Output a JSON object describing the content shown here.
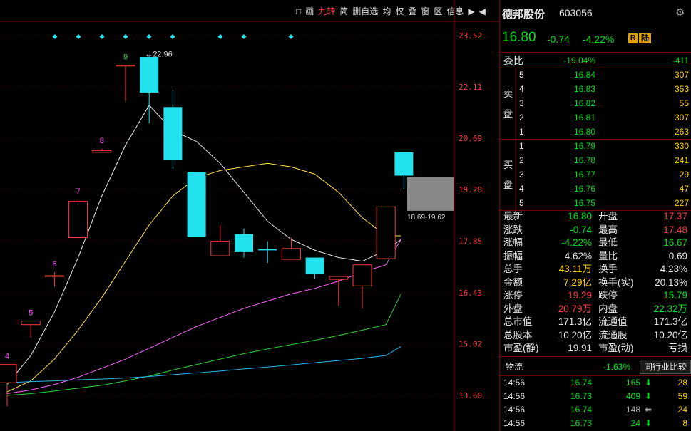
{
  "toolbar": {
    "items": [
      "□",
      "画",
      "九转",
      "简",
      "删自选",
      "均",
      "权",
      "叠",
      "窗",
      "区",
      "信息",
      "▶",
      "◀"
    ],
    "active_index": 2
  },
  "chart": {
    "yticks": [
      "23.52",
      "22.11",
      "20.69",
      "19.28",
      "17.85",
      "16.43",
      "15.02",
      "13.60"
    ],
    "high_label": "←22.96",
    "range_label": "18.69-19.62",
    "nine_turn": [
      "4",
      "5",
      "6",
      "7",
      "8",
      "9"
    ]
  },
  "chart_data": {
    "type": "candlestick",
    "ylim": [
      13.6,
      23.52
    ],
    "candles": [
      {
        "o": 13.95,
        "c": 14.45,
        "h": 14.45,
        "l": 13.3,
        "dir": "up",
        "label": "4"
      },
      {
        "o": 15.55,
        "c": 15.65,
        "h": 15.65,
        "l": 15.2,
        "dir": "up",
        "label": "5"
      },
      {
        "o": 16.88,
        "c": 16.9,
        "h": 17.0,
        "l": 16.6,
        "dir": "up",
        "label": "6"
      },
      {
        "o": 17.95,
        "c": 18.95,
        "h": 19.0,
        "l": 17.95,
        "dir": "up",
        "label": "7"
      },
      {
        "o": 20.3,
        "c": 20.35,
        "h": 20.4,
        "l": 20.3,
        "dir": "up",
        "label": "8"
      },
      {
        "o": 22.7,
        "c": 22.7,
        "h": 22.7,
        "l": 21.7,
        "dir": "up",
        "label": "9"
      },
      {
        "o": 22.93,
        "c": 21.95,
        "h": 22.96,
        "l": 21.1,
        "dir": "down"
      },
      {
        "o": 21.55,
        "c": 20.1,
        "h": 22.0,
        "l": 19.85,
        "dir": "down"
      },
      {
        "o": 19.75,
        "c": 17.98,
        "h": 19.75,
        "l": 17.98,
        "dir": "down"
      },
      {
        "o": 17.45,
        "c": 17.85,
        "h": 18.3,
        "l": 17.45,
        "dir": "up"
      },
      {
        "o": 18.05,
        "c": 17.55,
        "h": 18.2,
        "l": 17.4,
        "dir": "down"
      },
      {
        "o": 17.62,
        "c": 17.62,
        "h": 17.85,
        "l": 17.25,
        "dir": "flat"
      },
      {
        "o": 17.35,
        "c": 17.65,
        "h": 17.95,
        "l": 17.35,
        "dir": "up"
      },
      {
        "o": 17.4,
        "c": 16.95,
        "h": 17.4,
        "l": 16.8,
        "dir": "down"
      },
      {
        "o": 16.8,
        "c": 16.88,
        "h": 16.88,
        "l": 16.07,
        "dir": "up"
      },
      {
        "o": 16.62,
        "c": 17.2,
        "h": 17.2,
        "l": 16.0,
        "dir": "up"
      },
      {
        "o": 17.37,
        "c": 18.8,
        "h": 18.8,
        "l": 17.37,
        "dir": "up"
      },
      {
        "o": 20.3,
        "c": 19.66,
        "h": 20.3,
        "l": 19.28,
        "dir": "down"
      }
    ],
    "ma_series": [
      {
        "color": "#e8e8e8",
        "values": [
          13.9,
          14.7,
          15.9,
          17.4,
          19.1,
          20.5,
          21.6,
          20.9,
          20.6,
          20.0,
          19.2,
          18.4,
          17.9,
          17.6,
          17.4,
          17.3,
          17.6,
          17.9
        ]
      },
      {
        "color": "#ffe14a",
        "values": [
          13.7,
          14.0,
          14.6,
          15.4,
          16.3,
          17.3,
          18.3,
          19.1,
          19.6,
          19.8,
          19.9,
          20.0,
          19.9,
          19.7,
          19.2,
          18.5,
          18.0,
          18.0
        ]
      },
      {
        "color": "#ff66ff",
        "values": [
          13.65,
          13.75,
          13.9,
          14.1,
          14.35,
          14.6,
          14.9,
          15.2,
          15.5,
          15.75,
          16.0,
          16.2,
          16.4,
          16.55,
          16.75,
          17.0,
          17.2,
          17.9
        ]
      },
      {
        "color": "#2fd13a",
        "values": [
          13.6,
          13.65,
          13.72,
          13.8,
          13.88,
          14.0,
          14.13,
          14.3,
          14.45,
          14.6,
          14.75,
          14.88,
          15.0,
          15.12,
          15.25,
          15.4,
          15.55,
          16.4
        ]
      },
      {
        "color": "#27b6f0",
        "values": [
          13.95,
          13.98,
          14.0,
          14.03,
          14.05,
          14.08,
          14.12,
          14.17,
          14.22,
          14.27,
          14.33,
          14.38,
          14.44,
          14.5,
          14.56,
          14.62,
          14.7,
          14.95
        ]
      }
    ]
  },
  "stock": {
    "name": "德邦股份",
    "code": "603056",
    "price": "16.80",
    "change": "-0.74",
    "pct": "-4.22%",
    "badge_r": "R",
    "badge_lu": "陆"
  },
  "weibi": {
    "label": "委比",
    "pct": "-19.04%",
    "diff": "-411"
  },
  "sell_label": [
    "卖",
    "盘"
  ],
  "buy_label": [
    "买",
    "盘"
  ],
  "sell": [
    {
      "n": "5",
      "price": "16.84",
      "vol": "307"
    },
    {
      "n": "4",
      "price": "16.83",
      "vol": "353"
    },
    {
      "n": "3",
      "price": "16.82",
      "vol": "55"
    },
    {
      "n": "2",
      "price": "16.81",
      "vol": "307"
    },
    {
      "n": "1",
      "price": "16.80",
      "vol": "263"
    }
  ],
  "buy": [
    {
      "n": "1",
      "price": "16.79",
      "vol": "330"
    },
    {
      "n": "2",
      "price": "16.78",
      "vol": "241"
    },
    {
      "n": "3",
      "price": "16.77",
      "vol": "29"
    },
    {
      "n": "4",
      "price": "16.76",
      "vol": "47"
    },
    {
      "n": "5",
      "price": "16.75",
      "vol": "227"
    }
  ],
  "stats": [
    {
      "k1": "最新",
      "v1": "16.80",
      "c1": "green",
      "k2": "开盘",
      "v2": "17.37",
      "c2": "red"
    },
    {
      "k1": "涨跌",
      "v1": "-0.74",
      "c1": "green",
      "k2": "最高",
      "v2": "17.48",
      "c2": "red"
    },
    {
      "k1": "涨幅",
      "v1": "-4.22%",
      "c1": "green",
      "k2": "最低",
      "v2": "16.67",
      "c2": "green"
    },
    {
      "k1": "振幅",
      "v1": "4.62%",
      "c1": "white",
      "k2": "量比",
      "v2": "0.69",
      "c2": "white"
    },
    {
      "k1": "总手",
      "v1": "43.11万",
      "c1": "yellow",
      "k2": "换手",
      "v2": "4.23%",
      "c2": "white"
    },
    {
      "k1": "金额",
      "v1": "7.29亿",
      "c1": "yellow",
      "k2": "换手(实)",
      "v2": "20.13%",
      "c2": "white"
    },
    {
      "k1": "涨停",
      "v1": "19.29",
      "c1": "red",
      "k2": "跌停",
      "v2": "15.79",
      "c2": "green"
    },
    {
      "k1": "外盘",
      "v1": "20.79万",
      "c1": "red",
      "k2": "内盘",
      "v2": "22.32万",
      "c2": "green"
    },
    {
      "k1": "总市值",
      "v1": "171.3亿",
      "c1": "white",
      "k2": "流通值",
      "v2": "171.3亿",
      "c2": "white"
    },
    {
      "k1": "总股本",
      "v1": "10.20亿",
      "c1": "white",
      "k2": "流通股",
      "v2": "10.20亿",
      "c2": "white"
    },
    {
      "k1": "市盈(静)",
      "v1": "19.91",
      "c1": "white",
      "k2": "市盈(动)",
      "v2": "亏损",
      "c2": "white"
    }
  ],
  "industry": {
    "name": "物流",
    "pct": "-1.63%",
    "button": "同行业比较"
  },
  "ticks": [
    {
      "time": "14:56",
      "price": "16.74",
      "vol": "165",
      "arrow": "down",
      "num": "28"
    },
    {
      "time": "14:56",
      "price": "16.73",
      "vol": "409",
      "arrow": "down",
      "num": "59"
    },
    {
      "time": "14:56",
      "price": "16.74",
      "vol": "148",
      "arrow": "left",
      "num": "24"
    },
    {
      "time": "14:56",
      "price": "16.73",
      "vol": "24",
      "arrow": "down",
      "num": "8"
    }
  ],
  "arrows": {
    "down": "⬇",
    "left": "⬅"
  },
  "settings_icon": "⚙"
}
